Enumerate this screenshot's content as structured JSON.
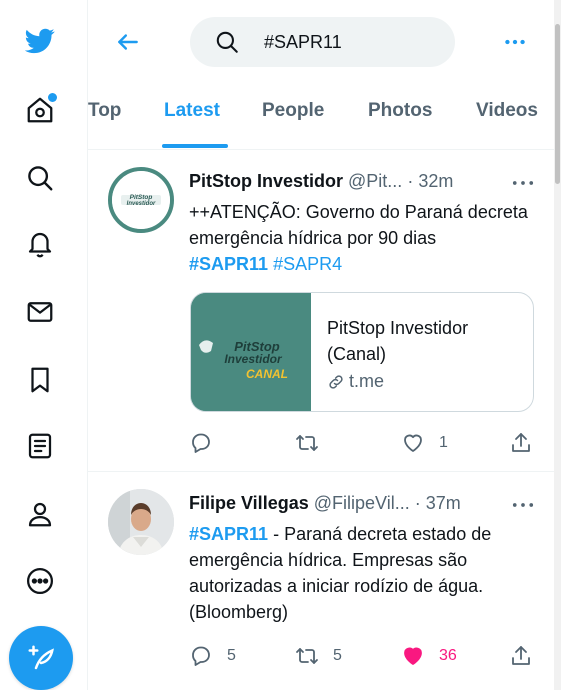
{
  "search": {
    "query": "#SAPR11"
  },
  "tabs": [
    {
      "label": "Top"
    },
    {
      "label": "Latest"
    },
    {
      "label": "People"
    },
    {
      "label": "Photos"
    },
    {
      "label": "Videos"
    }
  ],
  "active_tab": "Latest",
  "nav": [
    "twitter-logo",
    "home",
    "explore",
    "notifications",
    "messages",
    "bookmarks",
    "lists",
    "profile",
    "more"
  ],
  "tweets": [
    {
      "name": "PitStop Investidor",
      "handle": "@Pit...",
      "time": "32m",
      "dot": "·",
      "text_plain": "++ATENÇÃO: Governo do Paraná decreta emergência hídrica por 90 dias",
      "tag1": "#SAPR11",
      "tag2": "#SAPR4",
      "avatar_logo_text": "PitStop Investidor",
      "card": {
        "title": "PitStop Investidor (Canal)",
        "domain": "t.me",
        "thumb_text_1": "PitStop",
        "thumb_text_2": "Investidor",
        "thumb_text_3": "CANAL"
      },
      "actions": {
        "reply": "",
        "retweet": "",
        "like": "1"
      }
    },
    {
      "name": "Filipe Villegas",
      "handle": "@FilipeVil...",
      "time": "37m",
      "dot": "·",
      "tag1": "#SAPR11",
      "text_plain": "- Paraná decreta estado de emergência hídrica. Empresas são autorizadas a iniciar rodízio de água. (Bloomberg)",
      "actions": {
        "reply": "5",
        "retweet": "5",
        "like": "36"
      }
    }
  ],
  "colors": {
    "accent": "#1d9bf0",
    "like": "#f91880",
    "text": "#0f1419",
    "muted": "#536471"
  }
}
